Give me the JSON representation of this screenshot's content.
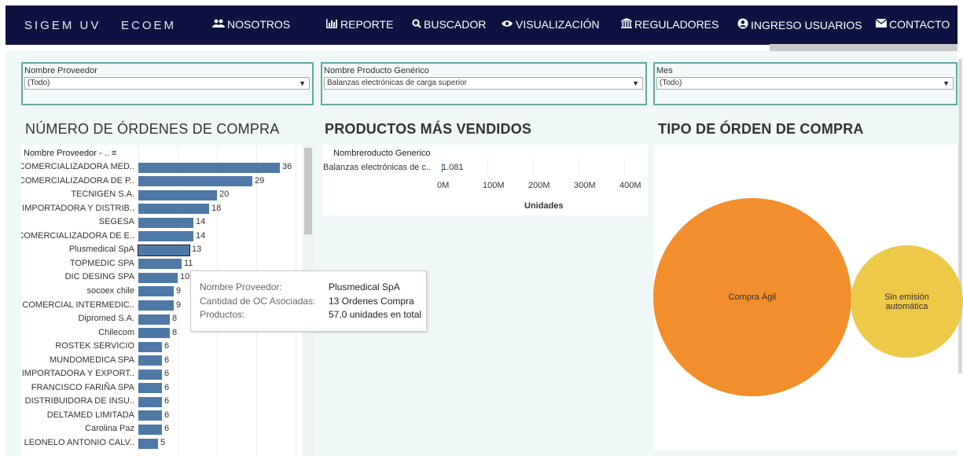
{
  "nav": {
    "brand1": "SIGEM UV",
    "brand2": "ECOEM",
    "items": [
      {
        "label": "NOSOTROS",
        "icon": "users-icon"
      },
      {
        "label": "REPORTE",
        "icon": "bar-chart-icon"
      },
      {
        "label": "BUSCADOR",
        "icon": "search-icon"
      },
      {
        "label": "VISUALIZACIÓN",
        "icon": "eye-icon"
      },
      {
        "label": "REGULADORES",
        "icon": "institution-icon"
      },
      {
        "label": "INGRESO USUARIOS",
        "icon": "user-circle-icon"
      },
      {
        "label": "CONTACTO",
        "icon": "envelope-icon"
      }
    ]
  },
  "filters": [
    {
      "label": "Nombre Proveedor",
      "value": "(Todo)"
    },
    {
      "label": "Nombre Producto Genérico",
      "value": "Balanzas electrónicas de carga superior"
    },
    {
      "label": "Mes",
      "value": "(Todo)"
    }
  ],
  "sections": {
    "orders_title": "NÚMERO DE ÓRDENES DE COMPRA",
    "products_title": "PRODUCTOS MÁS VENDIDOS",
    "type_title": "TIPO DE ÓRDEN DE COMPRA"
  },
  "bar_header": "Nombre Proveedor - .. ≡",
  "chart_data": [
    {
      "type": "bar",
      "orientation": "horizontal",
      "title": "NÚMERO DE ÓRDENES DE COMPRA",
      "ylabel": "Nombre Proveedor - ..",
      "categories": [
        "COMERCIALIZADORA MED..",
        "COMERCIALIZADORA DE P..",
        "TECNIGEN S.A.",
        "IMPORTADORA Y DISTRIB..",
        "SEGESA",
        "COMERCIALIZADORA DE E..",
        "Plusmedical SpA",
        "TOPMEDIC SPA",
        "DIC DESING SPA",
        "socoex chile",
        "COMERCIAL INTERMEDIC..",
        "Dipromed S.A.",
        "Chilecom",
        "ROSTEK SERVICIO",
        "MUNDOMEDICA SPA",
        "IMPORTADORA Y EXPORT..",
        "FRANCISCO FARIÑA SPA",
        "DISTRIBUIDORA DE INSU..",
        "DELTAMED LIMITADA",
        "Carolina Paz",
        "LEONELO ANTONIO CALV.."
      ],
      "values": [
        36,
        29,
        20,
        18,
        14,
        14,
        13,
        11,
        10,
        9,
        9,
        8,
        8,
        6,
        6,
        6,
        6,
        6,
        6,
        6,
        5
      ],
      "selected": "Plusmedical SpA",
      "color": "#4e79a7"
    },
    {
      "type": "bar",
      "orientation": "horizontal",
      "title": "PRODUCTOS MÁS VENDIDOS",
      "ylabel": "Nombreroducto Generico",
      "xlabel": "Unidades",
      "categories": [
        "Balanzas electrónicas de c.."
      ],
      "values": [
        1081
      ],
      "value_labels": [
        "1.081"
      ],
      "x_ticks": [
        "0M",
        "100M",
        "200M",
        "300M",
        "400M"
      ],
      "xlim": [
        0,
        400000000
      ]
    },
    {
      "type": "bubble",
      "title": "TIPO DE ÓRDEN DE COMPRA",
      "categories": [
        "Compra Ágil",
        "Sin emisión automática"
      ],
      "colors": [
        "#f28e2b",
        "#edc948"
      ]
    }
  ],
  "tooltip": {
    "rows": [
      {
        "key": "Nombre Proveedor:",
        "value": "Plusmedical SpA"
      },
      {
        "key": "Cantidad de OC Asociadas:",
        "value": "13 Ordenes Compra"
      },
      {
        "key": "Productos:",
        "value": "57,0 unidades en total"
      }
    ]
  }
}
